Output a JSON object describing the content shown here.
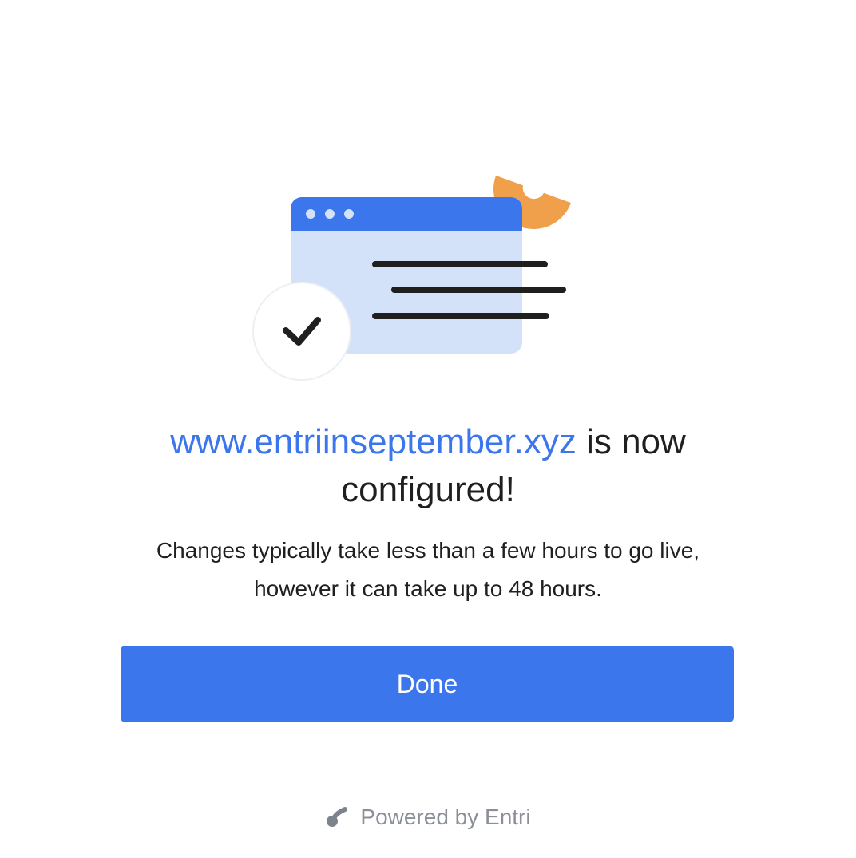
{
  "headline": {
    "domain": "www.entriinseptember.xyz",
    "suffix": " is now configured!"
  },
  "subtext": "Changes typically take less than a few hours to go live, however it can take up to 48 hours.",
  "done_button": {
    "label": "Done"
  },
  "footer": {
    "text": "Powered by Entri"
  },
  "colors": {
    "accent": "#3b76ec",
    "window_body": "#d3e2f9",
    "decor_orange": "#f0a04b",
    "text": "#1f1f1f",
    "muted": "#8a8f98"
  },
  "icons": {
    "illustration": "browser-window-illustration",
    "check": "checkmark-icon",
    "footer_logo": "entri-logo-icon"
  }
}
